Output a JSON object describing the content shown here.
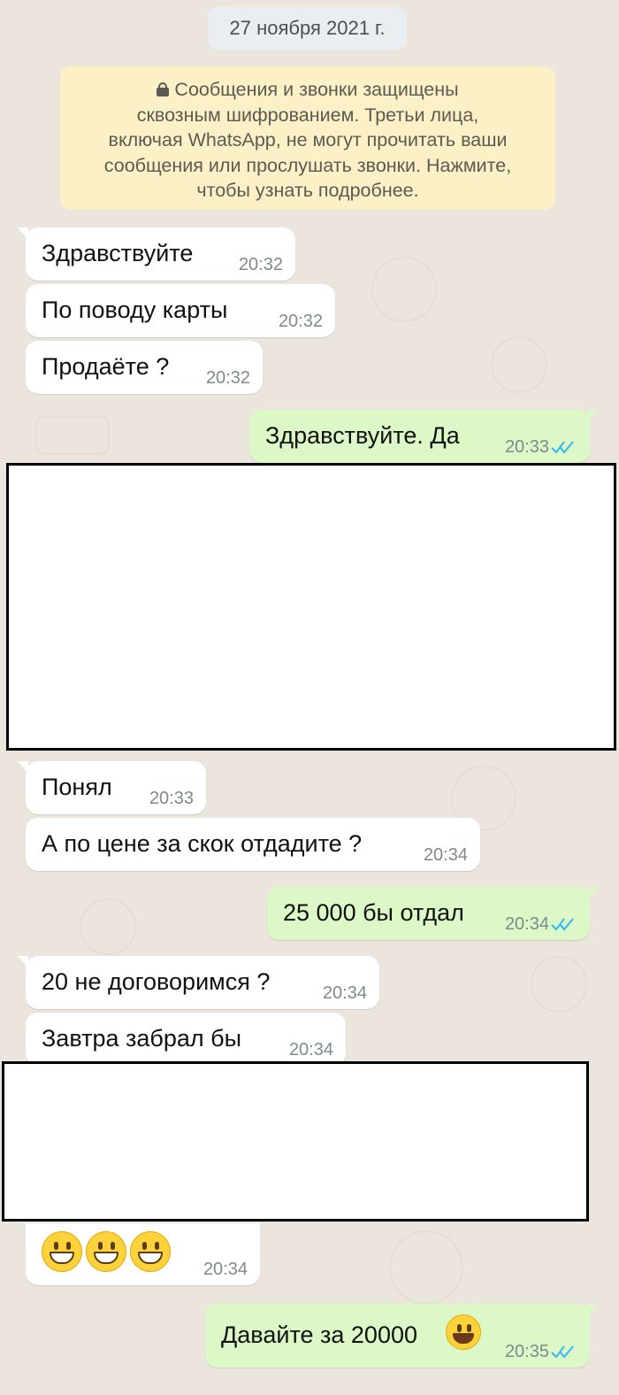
{
  "date_header": "27 ноября 2021 г.",
  "encryption_notice": {
    "icon": "lock-icon",
    "lines": [
      "Сообщения и звонки защищены",
      "сквозным шифрованием. Третьи лица,",
      "включая WhatsApp, не могут прочитать ваши",
      "сообщения или прослушать звонки. Нажмите,",
      "чтобы узнать подробнее."
    ]
  },
  "messages": [
    {
      "direction": "in",
      "text": "Здравствуйте",
      "time": "20:32"
    },
    {
      "direction": "in",
      "text": "По поводу карты",
      "time": "20:32"
    },
    {
      "direction": "in",
      "text": "Продаёте ?",
      "time": "20:32"
    },
    {
      "direction": "out",
      "text": "Здравствуйте. Да",
      "time": "20:33",
      "status": "read"
    },
    {
      "direction": "in",
      "text": "Понял",
      "time": "20:33"
    },
    {
      "direction": "in",
      "text": "А по цене за скок отдадите ?",
      "time": "20:34"
    },
    {
      "direction": "out",
      "text": "25 000 бы отдал",
      "time": "20:34",
      "status": "read"
    },
    {
      "direction": "in",
      "text": "20 не договоримся ?",
      "time": "20:34"
    },
    {
      "direction": "in",
      "text": "Завтра забрал бы",
      "time": "20:34"
    },
    {
      "direction": "in",
      "emoji": [
        "grinning-face-icon",
        "grinning-face-icon",
        "grinning-face-icon"
      ],
      "time": "20:34"
    },
    {
      "direction": "out",
      "text": "Давайте за 20000",
      "emoji": "smiling-face-icon",
      "time": "20:35",
      "status": "read"
    }
  ],
  "colors": {
    "chat_background": "#ece5dd",
    "incoming_bubble": "#ffffff",
    "outgoing_bubble": "#dcf8c6",
    "notice_background": "#fcf0c6",
    "read_ticks": "#34b7f1"
  }
}
